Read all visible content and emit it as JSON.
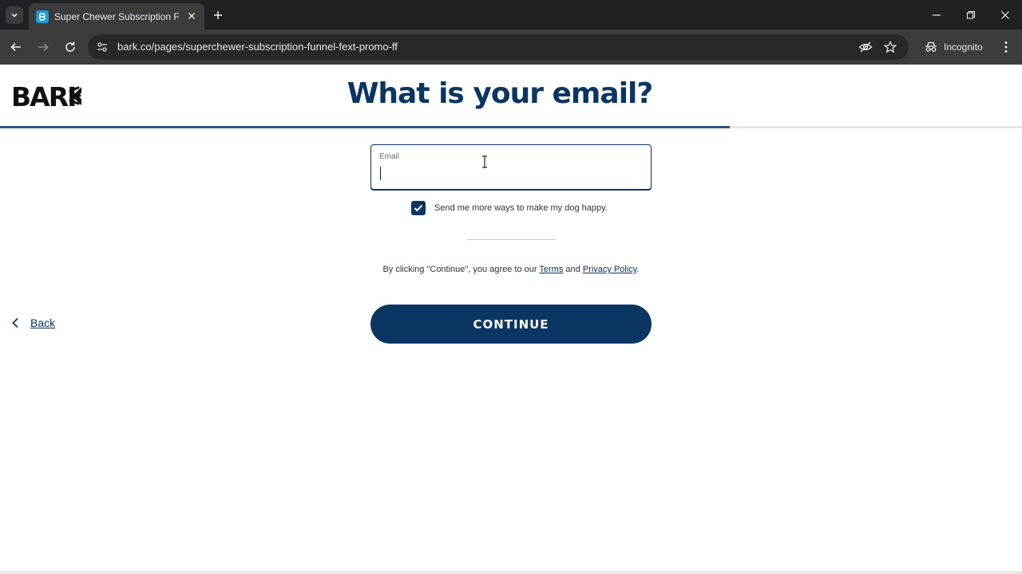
{
  "browser": {
    "tab_title": "Super Chewer Subscription Funnel",
    "url": "bark.co/pages/superchewer-subscription-funnel-fext-promo-ff",
    "incognito_label": "Incognito"
  },
  "page": {
    "logo_text": "BARK",
    "title": "What is your email?",
    "progress_fraction": 0.714,
    "email_field": {
      "label": "Email",
      "value": "",
      "placeholder": ""
    },
    "optin": {
      "checked": true,
      "label": "Send me more ways to make my dog happy."
    },
    "legal": {
      "prefix": "By clicking \"Continue\", you agree to our ",
      "terms_link": "Terms",
      "and_text": " and ",
      "privacy_link": "Privacy Policy",
      "suffix": "."
    },
    "back_label": "Back",
    "continue_label": "CONTINUE"
  },
  "colors": {
    "brand_navy": "#0b3563",
    "progress": "#2a5481",
    "chrome_dark": "#202124",
    "chrome_toolbar": "#3c3c3c"
  }
}
